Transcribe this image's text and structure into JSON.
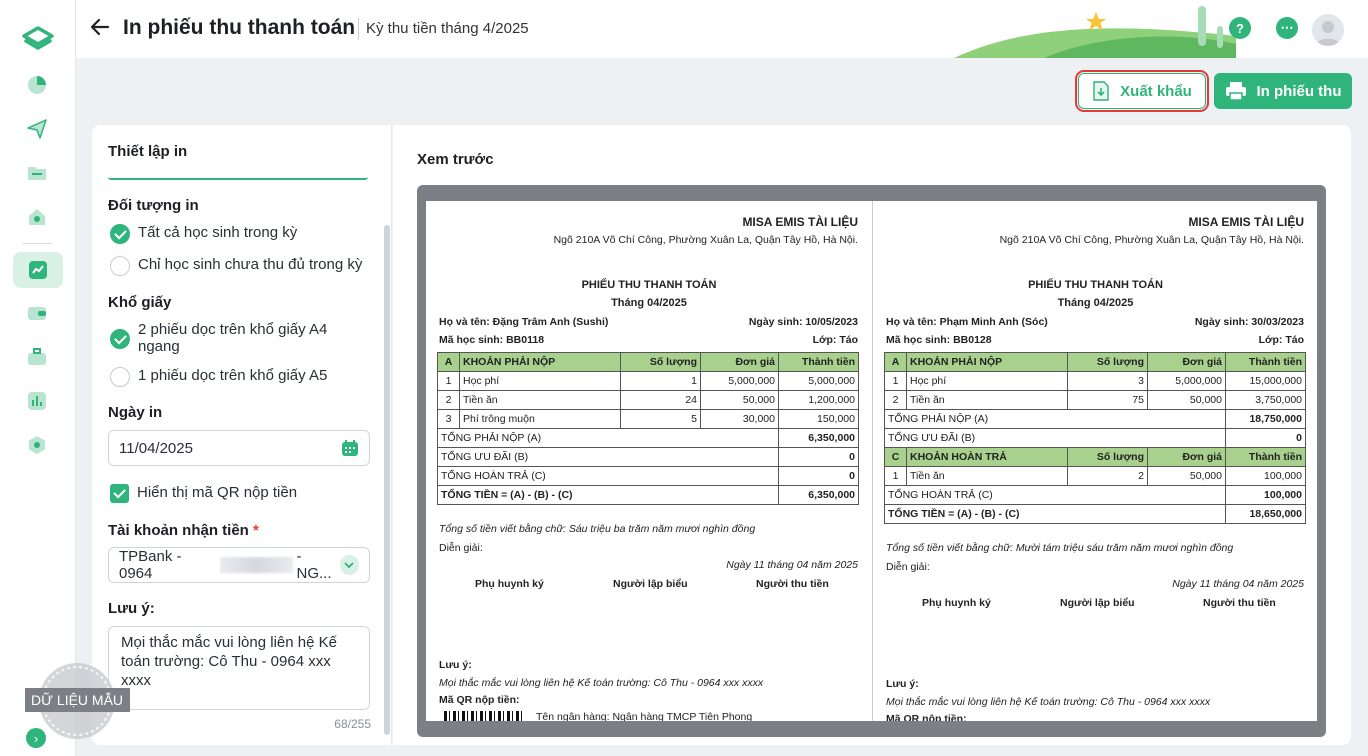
{
  "header": {
    "title": "In phiếu thu thanh toán",
    "subtitle": "Kỳ thu tiền tháng 4/2025",
    "help_icon": "?",
    "more_icon": "⋯"
  },
  "actions": {
    "export_label": "Xuất khẩu",
    "print_label": "In phiếu thu"
  },
  "settings": {
    "title": "Thiết lập in",
    "target_label": "Đối tượng in",
    "target_options": [
      "Tất cả học sinh trong kỳ",
      "Chỉ học sinh chưa thu đủ trong kỳ"
    ],
    "target_selected": 0,
    "paper_label": "Khổ giấy",
    "paper_options": [
      "2 phiếu dọc trên khổ giấy A4 ngang",
      "1 phiếu dọc trên khổ giấy A5"
    ],
    "paper_selected": 0,
    "date_label": "Ngày in",
    "date_value": "11/04/2025",
    "qr_label": "Hiển thị mã QR nộp tiền",
    "qr_checked": true,
    "account_label": "Tài khoản nhận tiền",
    "account_required": "*",
    "account_value_prefix": "TPBank - 0964",
    "account_value_suffix": "- NG...",
    "note_label": "Lưu ý:",
    "note_value": "Mọi thắc mắc vui lòng liên hệ Kế toán trường: Cô Thu - 0964 xxx xxxx",
    "note_counter": "68/255",
    "sample_stamp": "DỮ LIỆU MẪU"
  },
  "preview": {
    "title": "Xem trước",
    "receipts": [
      {
        "org": "MISA EMIS TÀI LIỆU",
        "address": "Ngõ 210A Võ Chí Công, Phường Xuân La, Quận Tây Hồ, Hà Nội.",
        "doc_title": "PHIẾU THU THANH TOÁN",
        "month": "Tháng 04/2025",
        "name": "Họ và tên: Đặng Trâm Anh (Sushi)",
        "dob": "Ngày sinh: 10/05/2023",
        "code": "Mã học sinh: BB0118",
        "class": "Lớp: Táo",
        "headers": [
          "A",
          "KHOẢN PHẢI NỘP",
          "Số lượng",
          "Đơn giá",
          "Thành tiền"
        ],
        "rows": [
          [
            "1",
            "Học phí",
            "1",
            "5,000,000",
            "5,000,000"
          ],
          [
            "2",
            "Tiền ăn",
            "24",
            "50,000",
            "1,200,000"
          ],
          [
            "3",
            "Phí trông muộn",
            "5",
            "30,000",
            "150,000"
          ]
        ],
        "total_payable_label": "TỔNG PHẢI NỘP (A)",
        "total_payable": "6,350,000",
        "discount_label": "TỔNG ƯU ĐÃI (B)",
        "discount": "0",
        "refund_label": "TỔNG HOÀN TRẢ (C)",
        "refund": "0",
        "total_label": "TỔNG TIỀN = (A) - (B) - (C)",
        "total": "6,350,000",
        "in_words": "Tổng số tiền viết bằng chữ: Sáu triệu ba trăm năm mươi nghìn đồng",
        "explain": "Diễn giải:",
        "date_line": "Ngày 11 tháng 04 năm 2025",
        "sign_parent": "Phụ huynh ký",
        "sign_maker": "Người lập biểu",
        "sign_cashier": "Người thu tiền",
        "note_label": "Lưu ý:",
        "note": "Mọi thắc mắc vui lòng liên hệ Kế toán trường: Cô Thu - 0964 xxx xxxx",
        "qr_label": "Mã QR nộp tiền:",
        "bank": "Tên ngân hàng: Ngân hàng TMCP Tiên Phong"
      },
      {
        "org": "MISA EMIS TÀI LIỆU",
        "address": "Ngõ 210A Võ Chí Công, Phường Xuân La, Quận Tây Hồ, Hà Nội.",
        "doc_title": "PHIẾU THU THANH TOÁN",
        "month": "Tháng 04/2025",
        "name": "Họ và tên: Phạm Minh Anh (Sóc)",
        "dob": "Ngày sinh: 30/03/2023",
        "code": "Mã học sinh: BB0128",
        "class": "Lớp: Táo",
        "headers": [
          "A",
          "KHOẢN PHẢI NỘP",
          "Số lượng",
          "Đơn giá",
          "Thành tiền"
        ],
        "rows": [
          [
            "1",
            "Học phí",
            "3",
            "5,000,000",
            "15,000,000"
          ],
          [
            "2",
            "Tiền ăn",
            "75",
            "50,000",
            "3,750,000"
          ]
        ],
        "total_payable_label": "TỔNG PHẢI NỘP (A)",
        "total_payable": "18,750,000",
        "discount_label": "TỔNG ƯU ĐÃI (B)",
        "discount": "0",
        "refund_headers": [
          "C",
          "KHOẢN HOÀN TRẢ",
          "Số lượng",
          "Đơn giá",
          "Thành tiền"
        ],
        "refund_rows": [
          [
            "1",
            "Tiền ăn",
            "2",
            "50,000",
            "100,000"
          ]
        ],
        "refund_label": "TỔNG HOÀN TRẢ (C)",
        "refund": "100,000",
        "total_label": "TỔNG TIỀN = (A) - (B) - (C)",
        "total": "18,650,000",
        "in_words": "Tổng số tiền viết bằng chữ: Mười tám triệu sáu trăm năm mươi nghìn đồng",
        "explain": "Diễn giải:",
        "date_line": "Ngày 11 tháng 04 năm 2025",
        "sign_parent": "Phụ huynh ký",
        "sign_maker": "Người lập biểu",
        "sign_cashier": "Người thu tiền",
        "note_label": "Lưu ý:",
        "note": "Mọi thắc mắc vui lòng liên hệ Kế toán trường: Cô Thu - 0964 xxx xxxx",
        "qr_label": "Mã QR nộp tiền:"
      }
    ]
  },
  "colors": {
    "accent": "#2fb47c",
    "highlight": "#e53935",
    "table_header": "#a9d18e"
  }
}
